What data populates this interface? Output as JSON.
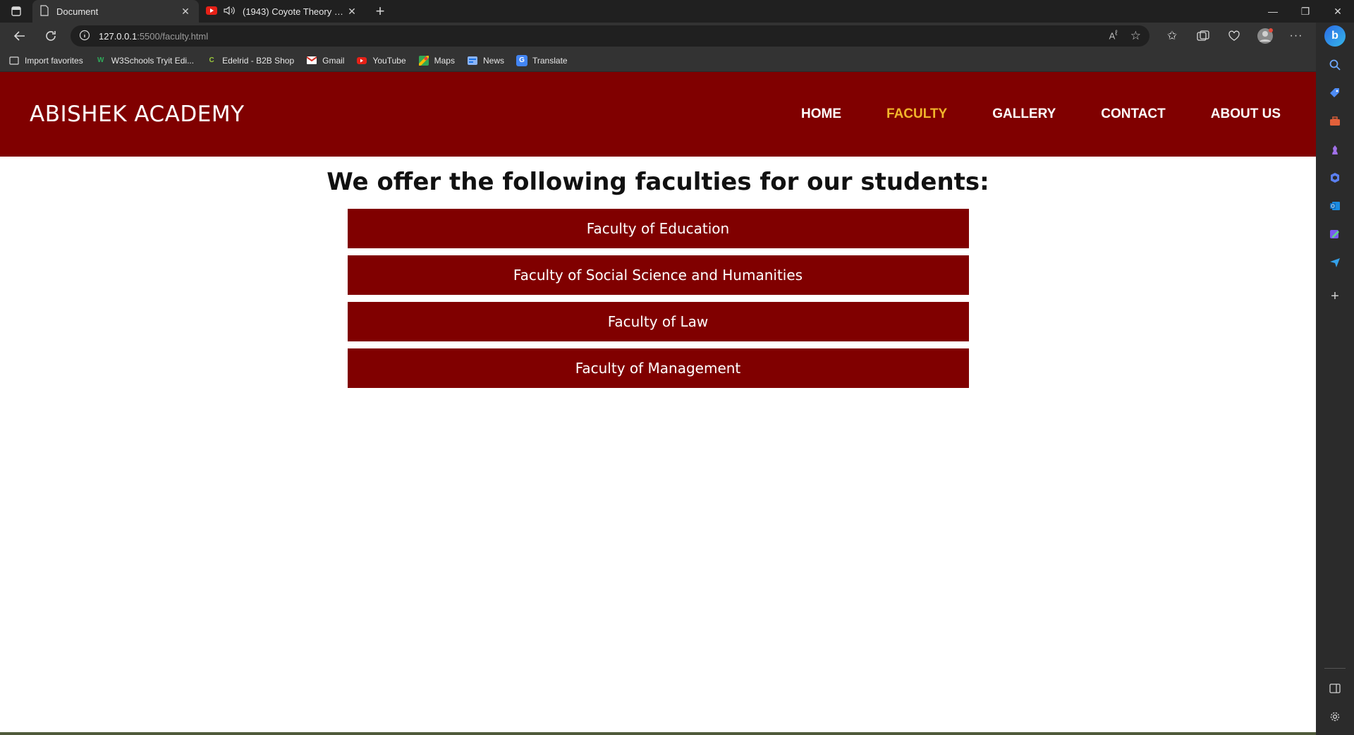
{
  "browser": {
    "tabs": [
      {
        "title": "Document",
        "active": true
      },
      {
        "title": "(1943) Coyote Theory - This",
        "active": false,
        "audio": true
      }
    ],
    "address": {
      "host": "127.0.0.1",
      "path": ":5500/faculty.html"
    },
    "bookmarks": [
      {
        "label": "Import favorites",
        "icon": "import-icon"
      },
      {
        "label": "W3Schools Tryit Edi...",
        "icon": "w3schools-icon"
      },
      {
        "label": "Edelrid - B2B Shop",
        "icon": "edelrid-icon"
      },
      {
        "label": "Gmail",
        "icon": "gmail-icon"
      },
      {
        "label": "YouTube",
        "icon": "youtube-icon"
      },
      {
        "label": "Maps",
        "icon": "maps-icon"
      },
      {
        "label": "News",
        "icon": "news-icon"
      },
      {
        "label": "Translate",
        "icon": "translate-icon"
      }
    ]
  },
  "site": {
    "brand": "ABISHEK ACADEMY",
    "nav": [
      {
        "label": "HOME",
        "active": false
      },
      {
        "label": "FACULTY",
        "active": true
      },
      {
        "label": "GALLERY",
        "active": false
      },
      {
        "label": "CONTACT",
        "active": false
      },
      {
        "label": "ABOUT US",
        "active": false
      }
    ],
    "heading": "We offer the following faculties for our students:",
    "faculties": [
      "Faculty of Education",
      "Faculty of Social Science and Humanities",
      "Faculty of Law",
      "Faculty of Management"
    ]
  },
  "colors": {
    "primary": "#800000",
    "nav_active": "#f1b52b",
    "background": "#ffffff"
  }
}
